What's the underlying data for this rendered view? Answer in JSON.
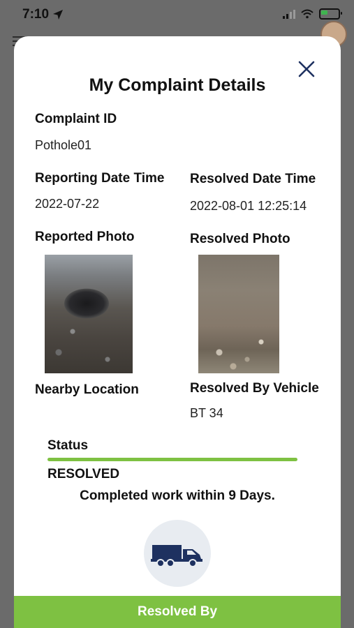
{
  "status_bar": {
    "time": "7:10"
  },
  "modal": {
    "title": "My Complaint Details",
    "complaint_id_label": "Complaint ID",
    "complaint_id": "Pothole01",
    "reporting_label": "Reporting Date Time",
    "reporting_value": "2022-07-22",
    "resolved_label": "Resolved Date Time",
    "resolved_value": "2022-08-01 12:25:14",
    "reported_photo_label": "Reported Photo",
    "resolved_photo_label": "Resolved Photo",
    "nearby_label": "Nearby Location",
    "vehicle_label": "Resolved By Vehicle",
    "vehicle_value": "BT 34",
    "status_label": "Status",
    "status_value": "RESOLVED",
    "completed_text": "Completed work within 9 Days.",
    "footer_button": "Resolved By",
    "accent_color": "#7ec142",
    "truck_color": "#1e3160"
  }
}
